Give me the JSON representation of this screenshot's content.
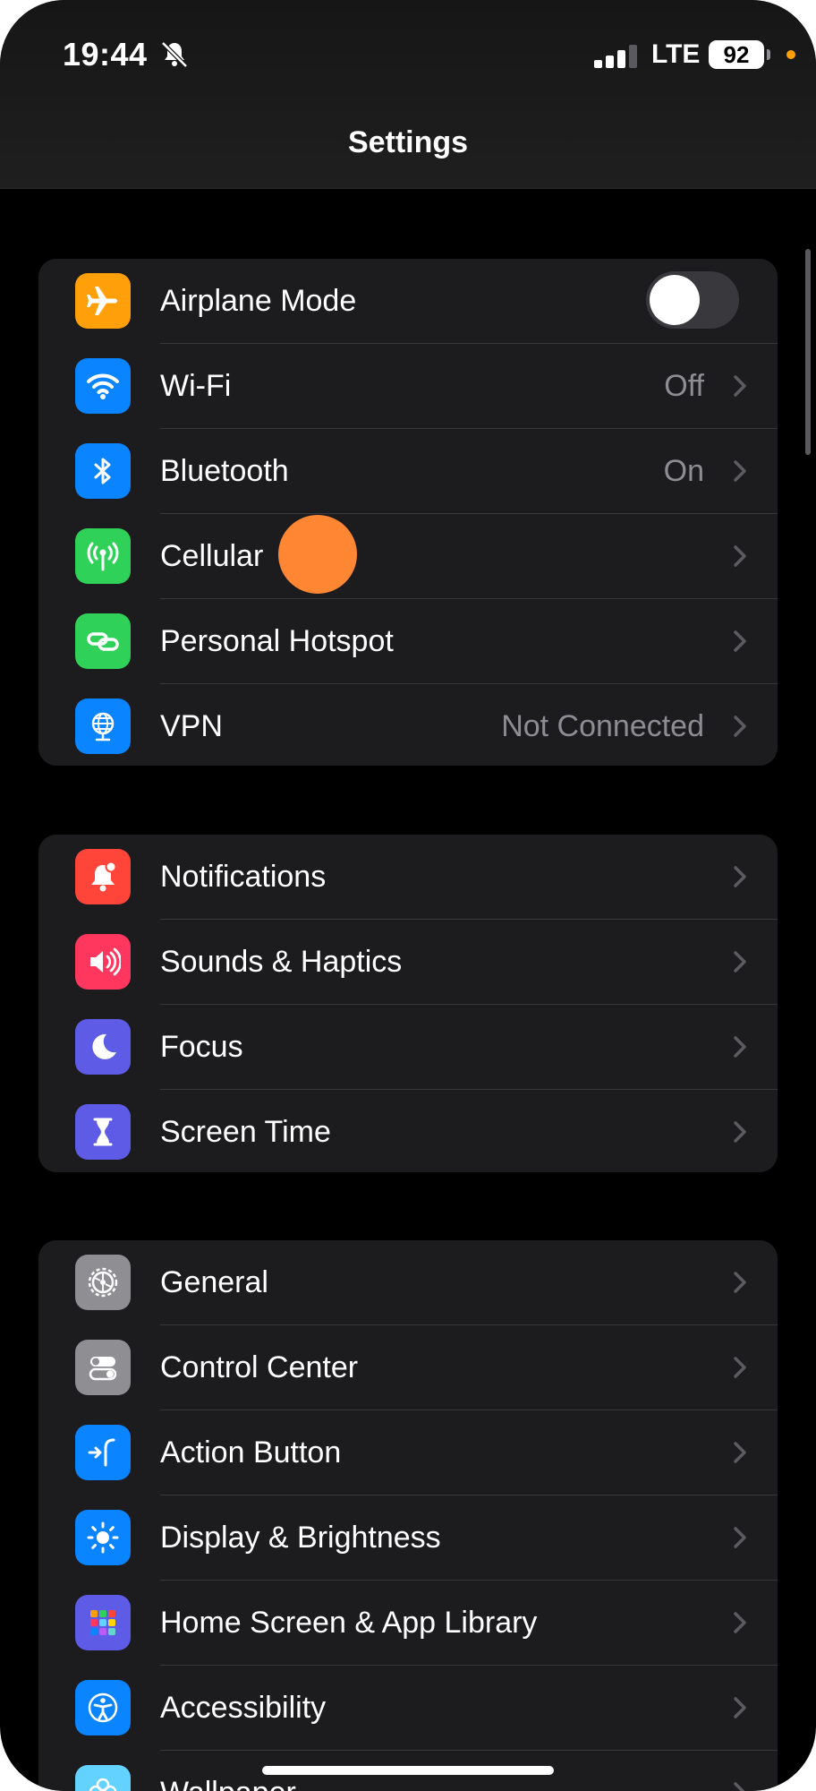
{
  "status_bar": {
    "time": "19:44",
    "network": "LTE",
    "battery": "92"
  },
  "nav": {
    "title": "Settings"
  },
  "groups": [
    {
      "rows": [
        {
          "label": "Airplane Mode",
          "icon": "airplane-icon",
          "color": "#ff9f0a",
          "toggle": "off"
        },
        {
          "label": "Wi-Fi",
          "value": "Off",
          "icon": "wifi-icon",
          "color": "#0a84ff"
        },
        {
          "label": "Bluetooth",
          "value": "On",
          "icon": "bluetooth-icon",
          "color": "#0a84ff"
        },
        {
          "label": "Cellular",
          "icon": "cellular-icon",
          "color": "#30d158"
        },
        {
          "label": "Personal Hotspot",
          "icon": "hotspot-icon",
          "color": "#30d158"
        },
        {
          "label": "VPN",
          "value": "Not Connected",
          "icon": "vpn-globe-icon",
          "color": "#0a84ff"
        }
      ]
    },
    {
      "rows": [
        {
          "label": "Notifications",
          "icon": "notifications-bell-icon",
          "color": "#ff453a"
        },
        {
          "label": "Sounds & Haptics",
          "icon": "speaker-icon",
          "color": "#ff375f"
        },
        {
          "label": "Focus",
          "icon": "moon-icon",
          "color": "#5e5ce6"
        },
        {
          "label": "Screen Time",
          "icon": "hourglass-icon",
          "color": "#5e5ce6"
        }
      ]
    },
    {
      "rows": [
        {
          "label": "General",
          "icon": "gear-icon",
          "color": "#8e8e93"
        },
        {
          "label": "Control Center",
          "icon": "switches-icon",
          "color": "#8e8e93"
        },
        {
          "label": "Action Button",
          "icon": "action-button-icon",
          "color": "#0a84ff"
        },
        {
          "label": "Display & Brightness",
          "icon": "sun-icon",
          "color": "#0a84ff"
        },
        {
          "label": "Home Screen & App Library",
          "icon": "app-grid-icon",
          "color": "#5e5ce6"
        },
        {
          "label": "Accessibility",
          "icon": "accessibility-icon",
          "color": "#0a84ff"
        },
        {
          "label": "Wallpaper",
          "icon": "flower-icon",
          "color": "#64d2ff"
        }
      ]
    }
  ]
}
